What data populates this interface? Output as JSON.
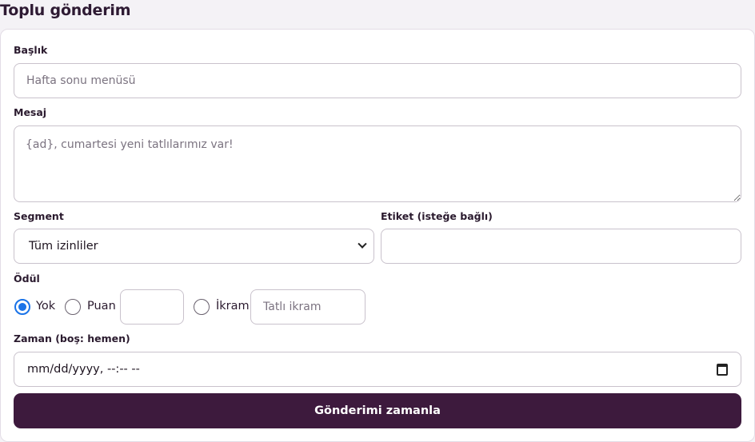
{
  "page": {
    "title": "Toplu gönderim"
  },
  "form": {
    "title_label": "Başlık",
    "title_placeholder": "Hafta sonu menüsü",
    "message_label": "Mesaj",
    "message_placeholder": "{ad}, cumartesi yeni tatlılarımız var!",
    "segment_label": "Segment",
    "segment_value": "Tüm izinliler",
    "tag_label": "Etiket (isteğe bağlı)",
    "tag_value": "",
    "reward_label": "Ödül",
    "reward_options": [
      {
        "label": "Yok",
        "checked": true
      },
      {
        "label": "Puan",
        "checked": false
      },
      {
        "label": "İkram",
        "checked": false
      }
    ],
    "points_value": "",
    "treat_placeholder": "Tatlı ikram",
    "schedule_label": "Zaman (boş: hemen)",
    "schedule_value": "mm/dd/yyyy, --:-- --",
    "submit_label": "Gönderimi zamanla"
  },
  "colors": {
    "accent": "#3d1a3d",
    "radio_checked": "#1a73e8",
    "page_bg": "#f4f2f6"
  },
  "icons": [
    "chevron-down-icon",
    "calendar-icon"
  ]
}
